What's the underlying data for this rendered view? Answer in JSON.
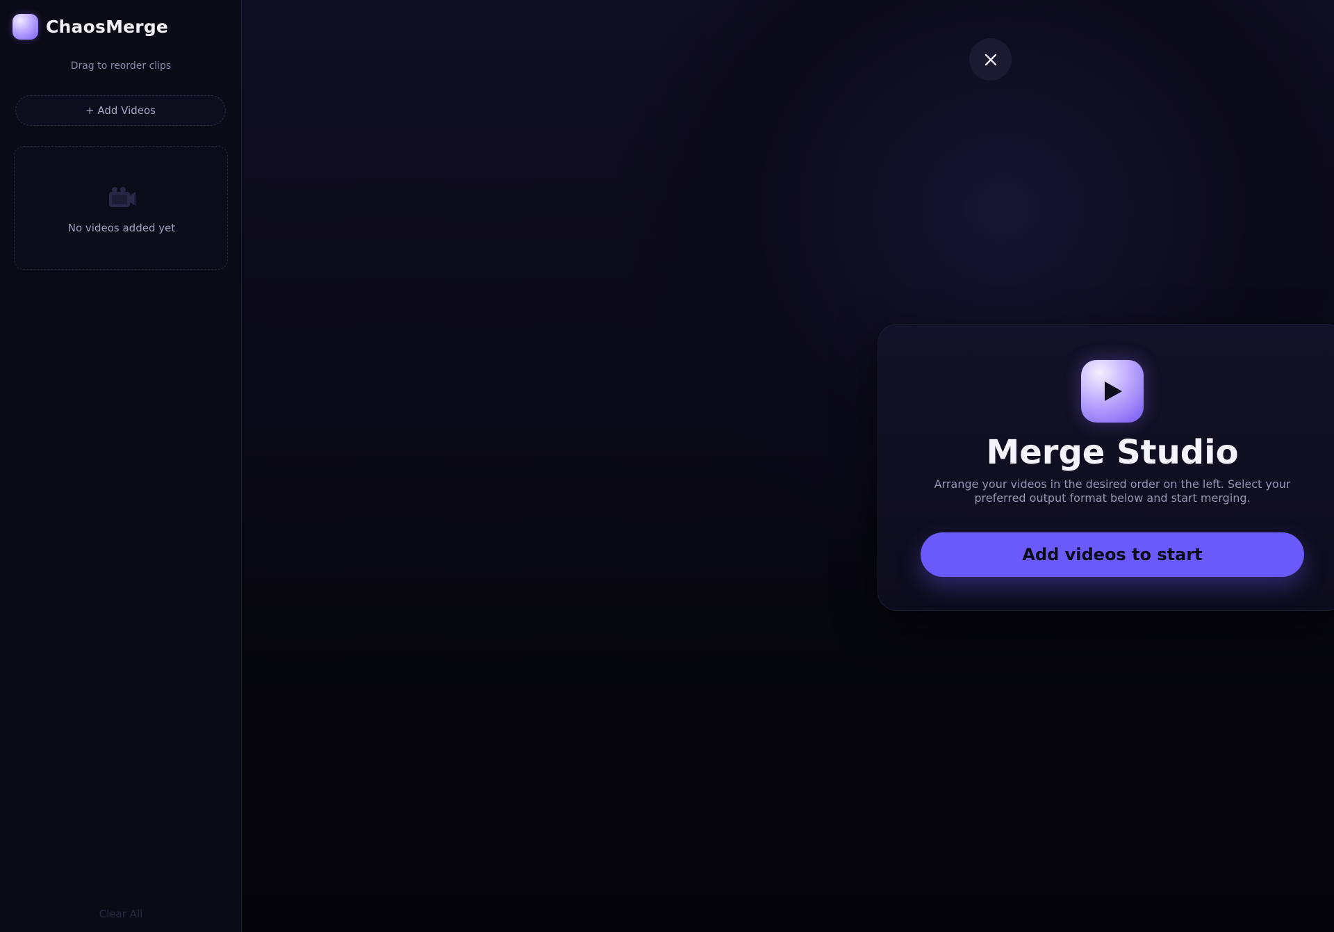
{
  "sidebar": {
    "brand_name": "ChaosMerge",
    "hint": "Drag to reorder clips",
    "add_videos_label": "+ Add Videos",
    "empty_state_text": "No videos added yet",
    "clear_all_label": "Clear All"
  },
  "main": {
    "close_icon": "close-icon",
    "card": {
      "icon": "play-icon",
      "title": "Merge Studio",
      "description": "Arrange your videos in the desired order on the left. Select your preferred output format below and start merging.",
      "start_button_label": "Add videos to start"
    }
  },
  "colors": {
    "accent": "#6a5af9",
    "sidebar_bg": "#0b0a17",
    "page_bg": "#06060c"
  }
}
